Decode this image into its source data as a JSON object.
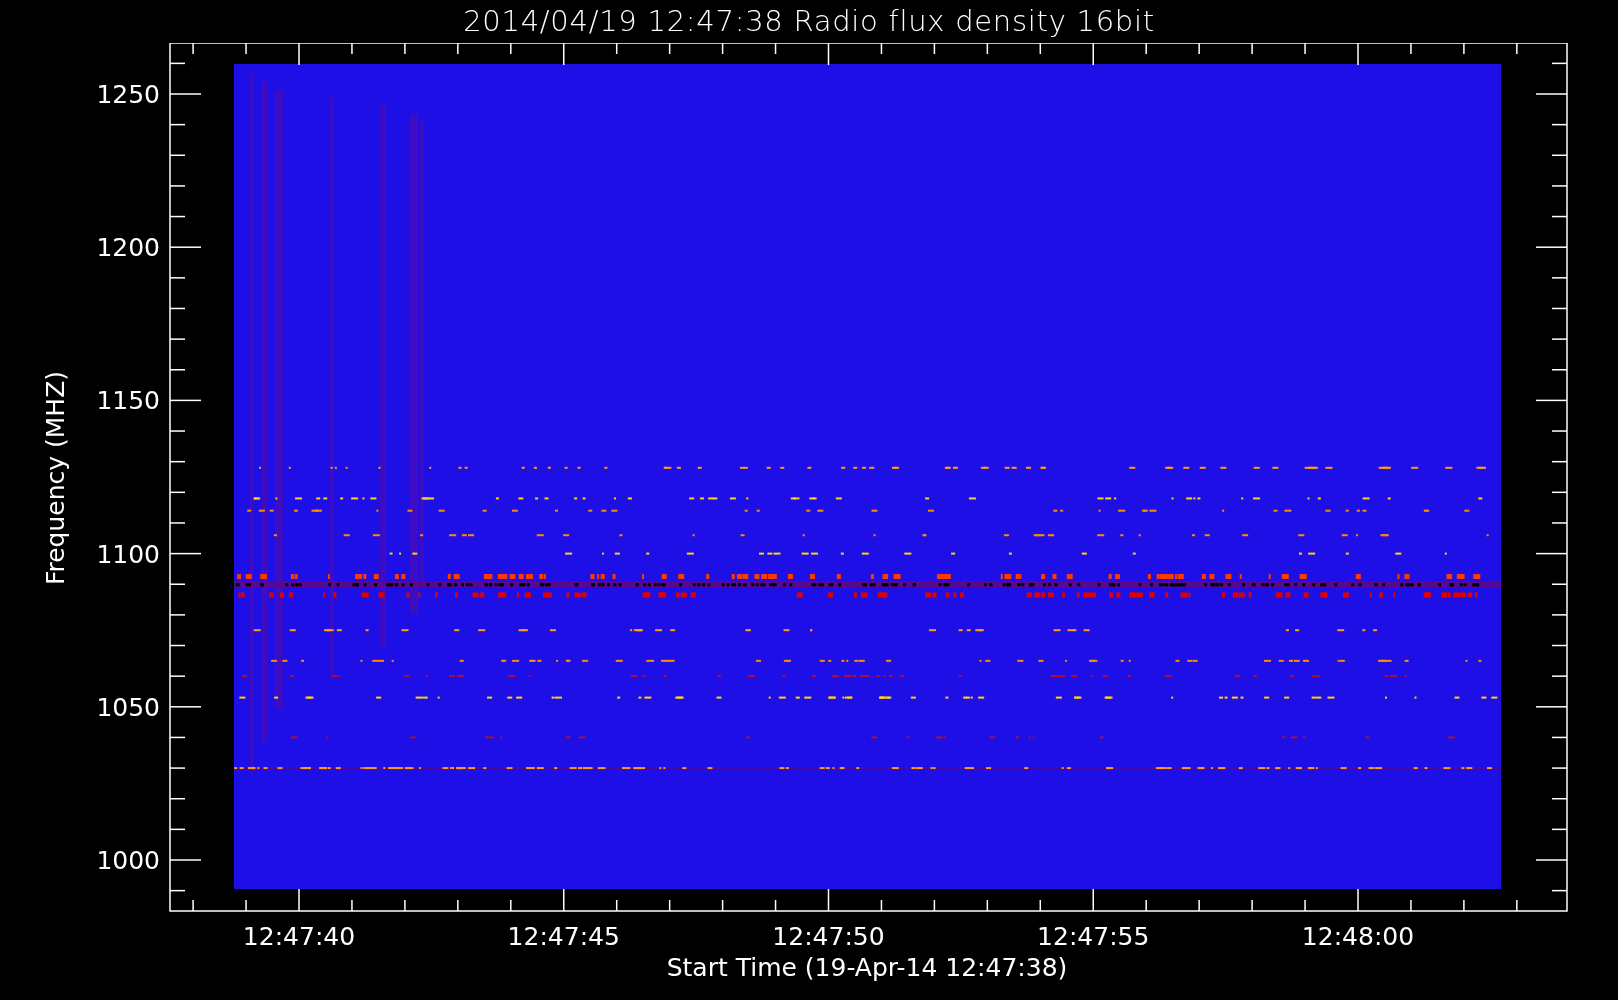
{
  "title": "2014/04/19 12:47:38 Radio flux density 16bit",
  "y_axis": {
    "label": "Frequency (MHZ)",
    "ticks": [
      "1250",
      "1200",
      "1150",
      "1100",
      "1050",
      "1000"
    ]
  },
  "x_axis": {
    "label": "Start Time (19-Apr-14 12:47:38)",
    "ticks": [
      "12:47:40",
      "12:47:45",
      "12:47:50",
      "12:47:55",
      "12:48:00"
    ]
  }
}
